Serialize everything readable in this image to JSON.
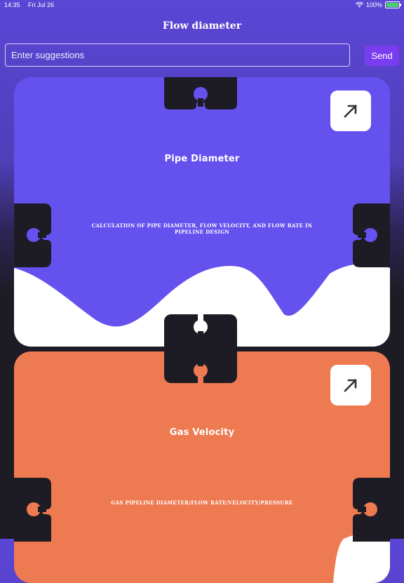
{
  "status_bar": {
    "time": "14:35",
    "date": "Fri Jul 26",
    "battery": "100%"
  },
  "nav": {
    "title": "Flow diameter"
  },
  "search": {
    "placeholder": "Enter suggestions",
    "value": ""
  },
  "send_label": "Send",
  "cards": [
    {
      "title": "Pipe Diameter",
      "description": "Calculation of pipe diameter, flow velocity, and flow rate in pipeline design",
      "color": "#6551ee",
      "icon": "arrow-up-right-icon"
    },
    {
      "title": "Gas Velocity",
      "description": "Gas pipeline diameter/flow rate/velocity/pressure",
      "color": "#ee7a52",
      "icon": "arrow-up-right-icon"
    }
  ],
  "colors": {
    "background_dark": "#1d1b24",
    "send_button": "#7a3cf0",
    "puzzle": "#1d1b24"
  }
}
